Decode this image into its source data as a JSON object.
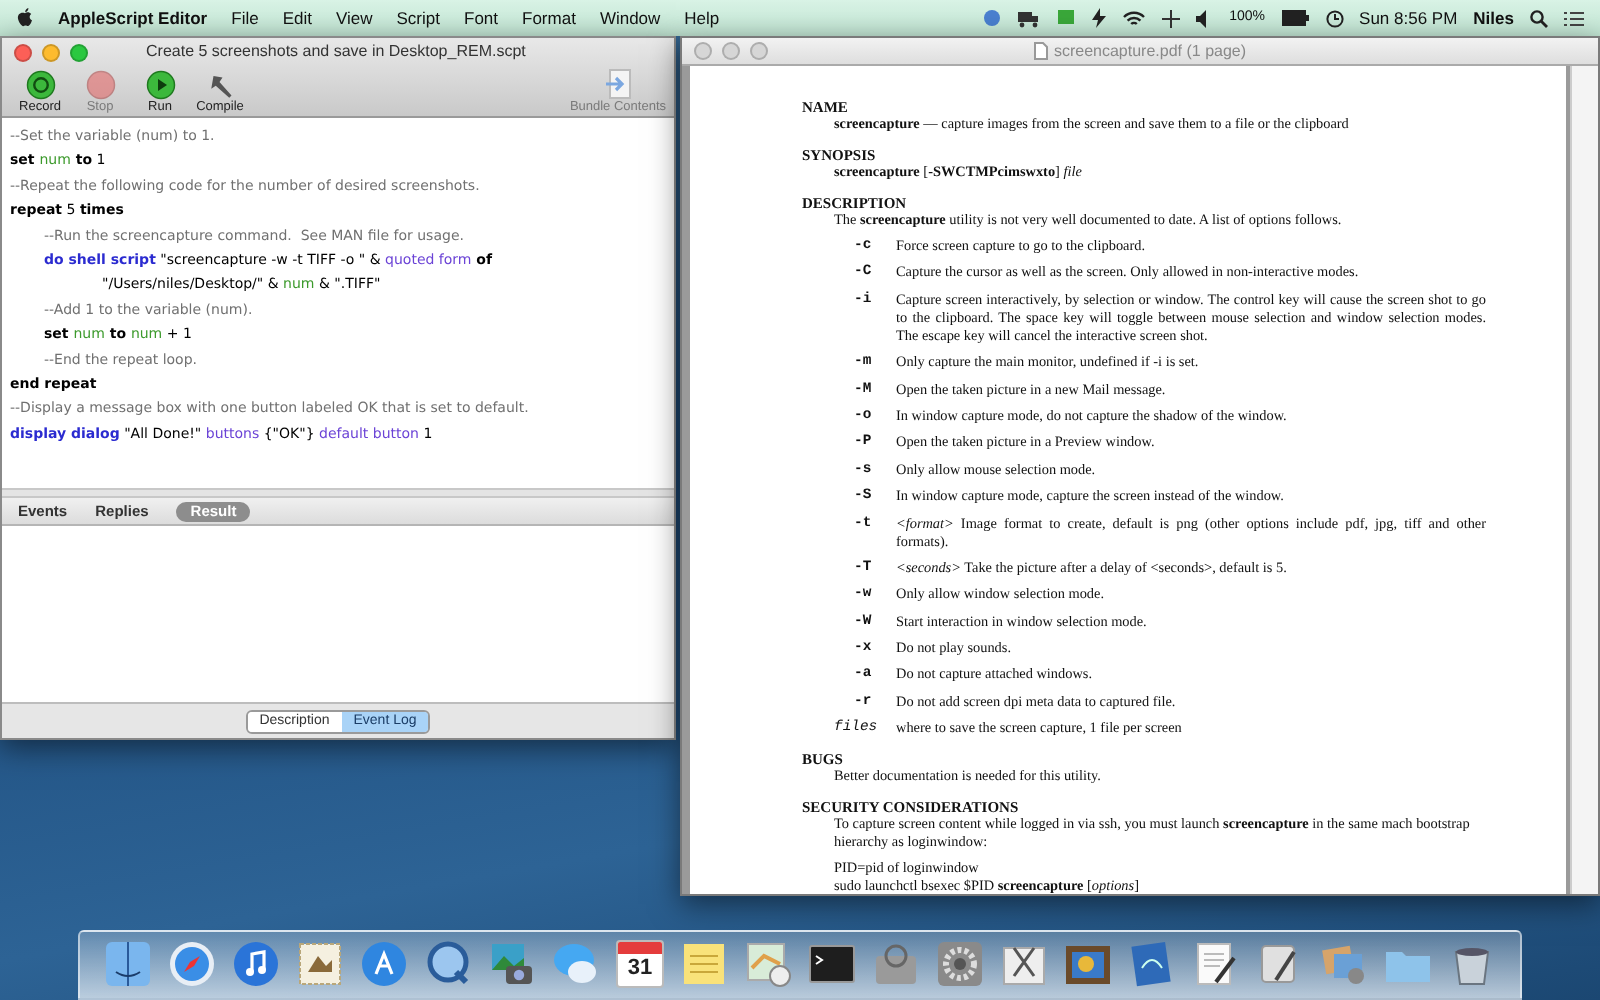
{
  "menubar": {
    "app": "AppleScript Editor",
    "items": [
      "File",
      "Edit",
      "View",
      "Script",
      "Font",
      "Format",
      "Window",
      "Help"
    ],
    "battery": "100%",
    "clock": "Sun 8:56 PM",
    "user": "Niles"
  },
  "editor": {
    "title": "Create 5 screenshots and save in Desktop_REM.scpt",
    "toolbar": [
      {
        "kind": "record",
        "label": "Record",
        "disabled": false
      },
      {
        "kind": "stop",
        "label": "Stop",
        "disabled": true
      },
      {
        "kind": "run",
        "label": "Run",
        "disabled": false
      },
      {
        "kind": "compile",
        "label": "Compile",
        "disabled": false
      }
    ],
    "bundle": {
      "label": "Bundle Contents",
      "disabled": true
    },
    "code": [
      {
        "tokens": [
          {
            "kind": "comment",
            "text": "--Set the variable (num) to 1."
          }
        ]
      },
      {
        "tokens": [
          {
            "kind": "keyword",
            "text": "set "
          },
          {
            "kind": "variable",
            "text": "num"
          },
          {
            "kind": "keyword",
            "text": " to"
          },
          {
            "kind": "plain",
            "text": " 1"
          }
        ]
      },
      {
        "tokens": [
          {
            "kind": "comment",
            "text": "--Repeat the following code for the number of desired screenshots."
          }
        ]
      },
      {
        "tokens": [
          {
            "kind": "keyword",
            "text": "repeat"
          },
          {
            "kind": "plain",
            "text": " 5 "
          },
          {
            "kind": "keyword",
            "text": "times"
          }
        ],
        "children": [
          {
            "tokens": [
              {
                "kind": "comment",
                "text": "--Run the screencapture command.  See MAN file for usage."
              }
            ]
          },
          {
            "tokens": [
              {
                "kind": "command",
                "text": "do shell script"
              },
              {
                "kind": "plain",
                "text": " \"screencapture -w -t TIFF -o \" & "
              },
              {
                "kind": "class",
                "text": "quoted form"
              },
              {
                "kind": "keyword",
                "text": " of"
              },
              {
                "kind": "plain",
                "text": " \"/Users/niles/Desktop/\" & "
              },
              {
                "kind": "variable",
                "text": "num"
              },
              {
                "kind": "plain",
                "text": " & \".TIFF\""
              }
            ]
          },
          {
            "tokens": [
              {
                "kind": "comment",
                "text": "--Add 1 to the variable (num)."
              }
            ]
          },
          {
            "tokens": [
              {
                "kind": "keyword",
                "text": "set "
              },
              {
                "kind": "variable",
                "text": "num"
              },
              {
                "kind": "keyword",
                "text": " to "
              },
              {
                "kind": "variable",
                "text": "num"
              },
              {
                "kind": "plain",
                "text": " + 1"
              }
            ]
          },
          {
            "tokens": [
              {
                "kind": "comment",
                "text": "--End the repeat loop."
              }
            ]
          }
        ]
      },
      {
        "tokens": [
          {
            "kind": "keyword",
            "text": "end repeat"
          }
        ]
      },
      {
        "tokens": [
          {
            "kind": "comment",
            "text": "--Display a message box with one button labeled OK that is set to default."
          }
        ]
      },
      {
        "tokens": [
          {
            "kind": "command",
            "text": "display dialog"
          },
          {
            "kind": "plain",
            "text": " \"All Done!\" "
          },
          {
            "kind": "class",
            "text": "buttons"
          },
          {
            "kind": "plain",
            "text": " {\"OK\"} "
          },
          {
            "kind": "class",
            "text": "default button"
          },
          {
            "kind": "plain",
            "text": " 1"
          }
        ]
      }
    ],
    "tabs": [
      {
        "label": "Events",
        "selected": false
      },
      {
        "label": "Replies",
        "selected": false
      },
      {
        "label": "Result",
        "selected": true
      }
    ],
    "views": [
      {
        "label": "Description",
        "selected": false
      },
      {
        "label": "Event Log",
        "selected": true
      }
    ]
  },
  "viewer": {
    "title": "screencapture.pdf (1 page)",
    "name": {
      "heading": "NAME",
      "text": "**screencapture** — capture images from the screen and save them to a file or the clipboard"
    },
    "synopsis": {
      "heading": "SYNOPSIS",
      "text": "**screencapture** [**-SWCTMPcimswxto**] *file*"
    },
    "description": {
      "heading": "DESCRIPTION",
      "intro": "The **screencapture** utility is not very well documented to date.  A list of options follows.",
      "options": [
        {
          "flag": "-c",
          "kind": "flag",
          "text": "Force screen capture to go to the clipboard."
        },
        {
          "flag": "-C",
          "kind": "flag",
          "text": "Capture the cursor as well as the screen.  Only allowed in non-interactive modes."
        },
        {
          "flag": "-i",
          "kind": "flag",
          "text": "Capture screen interactively, by selection or window.  The control key will cause the screen shot to go to the clipboard.  The space key will toggle between mouse selection and window selection modes.  The escape key will cancel the interactive screen shot."
        },
        {
          "flag": "-m",
          "kind": "flag",
          "text": "Only capture the main monitor, undefined if -i is set."
        },
        {
          "flag": "-M",
          "kind": "flag",
          "text": "Open the taken picture in a new Mail message."
        },
        {
          "flag": "-o",
          "kind": "flag",
          "text": "In window capture mode, do not capture the shadow of the window."
        },
        {
          "flag": "-P",
          "kind": "flag",
          "text": "Open the taken picture in a Preview window."
        },
        {
          "flag": "-s",
          "kind": "flag",
          "text": "Only allow mouse selection mode."
        },
        {
          "flag": "-S",
          "kind": "flag",
          "text": "In window capture mode, capture the screen instead of the window."
        },
        {
          "flag": "-t",
          "kind": "flag",
          "text": "*<format>* Image format to create, default is png (other options include pdf, jpg, tiff and other formats)."
        },
        {
          "flag": "-T",
          "kind": "flag",
          "text": "*<seconds>* Take the picture after a delay of <seconds>, default is 5."
        },
        {
          "flag": "-w",
          "kind": "flag",
          "text": "Only allow window selection mode."
        },
        {
          "flag": "-W",
          "kind": "flag",
          "text": "Start interaction in window selection mode."
        },
        {
          "flag": "-x",
          "kind": "flag",
          "text": "Do not play sounds."
        },
        {
          "flag": "-a",
          "kind": "flag",
          "text": "Do not capture attached windows."
        },
        {
          "flag": "-r",
          "kind": "flag",
          "text": "Do not add screen dpi meta data to captured file."
        },
        {
          "flag": "files",
          "kind": "argument",
          "text": "where to save the screen capture, 1 file per screen"
        }
      ]
    },
    "bugs": {
      "heading": "BUGS",
      "text": "Better documentation is needed for this utility."
    },
    "security": {
      "heading": "SECURITY CONSIDERATIONS",
      "text": "To capture screen content while logged in via ssh, you must launch **screencapture** in the same mach bootstrap hierarchy as loginwindow:",
      "lines": [
        "PID=pid of loginwindow",
        "sudo launchctl bsexec $PID **screencapture** [*options*]"
      ]
    }
  },
  "dock": [
    {
      "kind": "finder"
    },
    {
      "kind": "compass"
    },
    {
      "kind": "music"
    },
    {
      "kind": "stamp"
    },
    {
      "kind": "pencil"
    },
    {
      "kind": "q"
    },
    {
      "kind": "camera"
    },
    {
      "kind": "chat"
    },
    {
      "kind": "calendar",
      "text": "31"
    },
    {
      "kind": "notes"
    },
    {
      "kind": "map"
    },
    {
      "kind": "terminal"
    },
    {
      "kind": "drive"
    },
    {
      "kind": "gear"
    },
    {
      "kind": "scissors"
    },
    {
      "kind": "frame"
    },
    {
      "kind": "blueprint"
    },
    {
      "kind": "textedit"
    },
    {
      "kind": "script"
    },
    {
      "kind": "photos"
    },
    {
      "kind": "folder"
    },
    {
      "kind": "trash"
    }
  ]
}
